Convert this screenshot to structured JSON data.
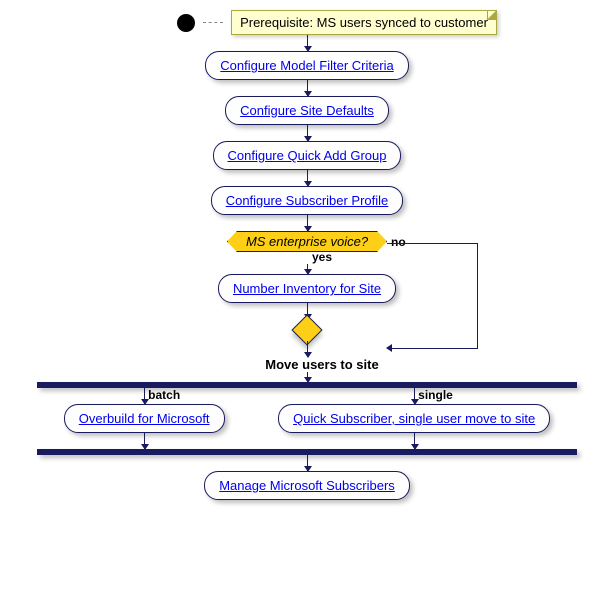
{
  "note": "Prerequisite: MS users synced to customer",
  "steps": {
    "config_model": "Configure Model Filter Criteria",
    "config_site": "Configure Site Defaults",
    "config_quick": "Configure Quick Add Group",
    "config_sub": "Configure Subscriber Profile",
    "number_inv": "Number Inventory for Site",
    "overbuild": "Overbuild for Microsoft",
    "quick_sub": "Quick Subscriber, single user move to site",
    "manage": "Manage Microsoft Subscribers"
  },
  "decision": {
    "question": "MS enterprise voice?",
    "yes": "yes",
    "no": "no"
  },
  "section": "Move users to site",
  "parallel": {
    "batch": "batch",
    "single": "single"
  },
  "chart_data": {
    "type": "activity-diagram",
    "start_note": "Prerequisite: MS users synced to customer",
    "sequence": [
      "Configure Model Filter Criteria",
      "Configure Site Defaults",
      "Configure Quick Add Group",
      "Configure Subscriber Profile"
    ],
    "decision": {
      "guard": "MS enterprise voice?",
      "yes": [
        "Number Inventory for Site"
      ],
      "no": []
    },
    "merge_label": "Move users to site",
    "fork": {
      "batch": [
        "Overbuild for Microsoft"
      ],
      "single": [
        "Quick Subscriber, single user move to site"
      ]
    },
    "after_join": [
      "Manage Microsoft Subscribers"
    ]
  }
}
